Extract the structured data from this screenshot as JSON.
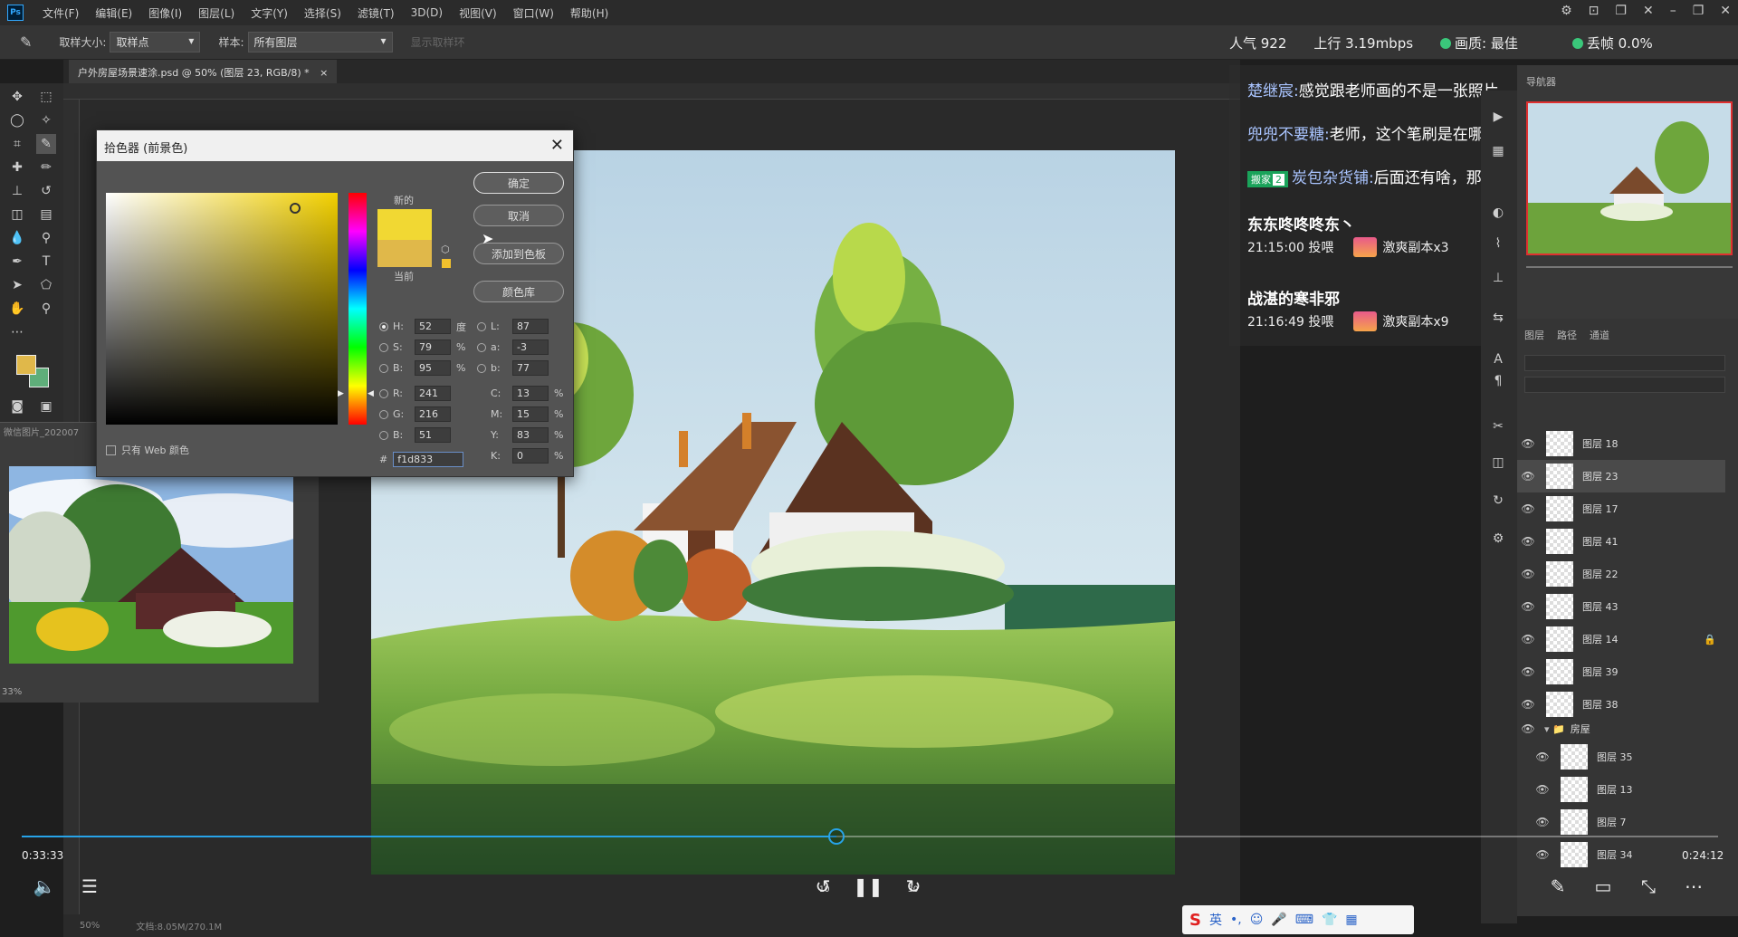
{
  "app": {
    "logo": "Ps"
  },
  "menu": [
    "文件(F)",
    "编辑(E)",
    "图像(I)",
    "图层(L)",
    "文字(Y)",
    "选择(S)",
    "滤镜(T)",
    "3D(D)",
    "视图(V)",
    "窗口(W)",
    "帮助(H)"
  ],
  "options": {
    "sample_size_label": "取样大小:",
    "sample_size_value": "取样点",
    "sample_label": "样本:",
    "sample_value": "所有图层",
    "show_ring": "显示取样环"
  },
  "document": {
    "tab_title": "户外房屋场景速涂.psd @ 50% (图层 23, RGB/8) *",
    "tab_close": "×"
  },
  "reference": {
    "title": "微信图片_202007",
    "zoom": "33%"
  },
  "status": {
    "zoom": "50%",
    "doc": "文档:8.05M/270.1M"
  },
  "picker": {
    "title": "拾色器 (前景色)",
    "new_label": "新的",
    "current_label": "当前",
    "ok": "确定",
    "cancel": "取消",
    "add_swatch": "添加到色板",
    "libraries": "颜色库",
    "web_only": "只有 Web 颜色",
    "new_color": "#f1d833",
    "current_color": "#e0b84a",
    "hsb": [
      {
        "label": "H:",
        "value": "52",
        "unit": "度"
      },
      {
        "label": "S:",
        "value": "79",
        "unit": "%"
      },
      {
        "label": "B:",
        "value": "95",
        "unit": "%"
      }
    ],
    "rgb": [
      {
        "label": "R:",
        "value": "241"
      },
      {
        "label": "G:",
        "value": "216"
      },
      {
        "label": "B:",
        "value": "51"
      }
    ],
    "lab": [
      {
        "label": "L:",
        "value": "87"
      },
      {
        "label": "a:",
        "value": "-3"
      },
      {
        "label": "b:",
        "value": "77"
      }
    ],
    "cmyk": [
      {
        "label": "C:",
        "value": "13",
        "unit": "%"
      },
      {
        "label": "M:",
        "value": "15",
        "unit": "%"
      },
      {
        "label": "Y:",
        "value": "83",
        "unit": "%"
      },
      {
        "label": "K:",
        "value": "0",
        "unit": "%"
      }
    ],
    "hex_label": "#",
    "hex": "f1d833"
  },
  "live": {
    "popularity": "人气 922",
    "upload": "上行 3.19mbps",
    "quality": "画质: 最佳",
    "drop": "丢帧 0.0%"
  },
  "chat": [
    {
      "name": "楚继宸:",
      "text": "感觉跟老师画的不是一张照片"
    },
    {
      "name": "兜兜不要糖:",
      "text": "老师，这个笔刷是在哪里呢?"
    },
    {
      "badge": "搬家",
      "level": "2",
      "name": "炭包杂货铺:",
      "text": "后面还有啥，那颗花树吗"
    }
  ],
  "gifts": [
    {
      "user": "东东咚咚咚东丶",
      "time": "21:15:00 投喂",
      "item": "激爽副本x3"
    },
    {
      "user": "战湛的寒非邪",
      "time": "21:16:49 投喂",
      "item": "激爽副本x9"
    }
  ],
  "navigator": {
    "tab": "导航器"
  },
  "layers": {
    "tabs": [
      "图层",
      "路径",
      "通道"
    ],
    "items": [
      {
        "name": "图层 18"
      },
      {
        "name": "图层 23"
      },
      {
        "name": "图层 17"
      },
      {
        "name": "图层 41"
      },
      {
        "name": "图层 22"
      },
      {
        "name": "图层 43"
      },
      {
        "name": "图层 14"
      },
      {
        "name": "图层 39"
      },
      {
        "name": "图层 38"
      },
      {
        "name": "房屋"
      },
      {
        "name": "图层 35"
      },
      {
        "name": "图层 13"
      },
      {
        "name": "图层 7"
      },
      {
        "name": "图层 34"
      }
    ]
  },
  "player": {
    "elapsed": "0:33:33",
    "remaining": "0:24:12",
    "progress": 0.48,
    "rewind": "10",
    "forward": "30"
  },
  "ime": {
    "logo": "S",
    "lang": "英"
  }
}
